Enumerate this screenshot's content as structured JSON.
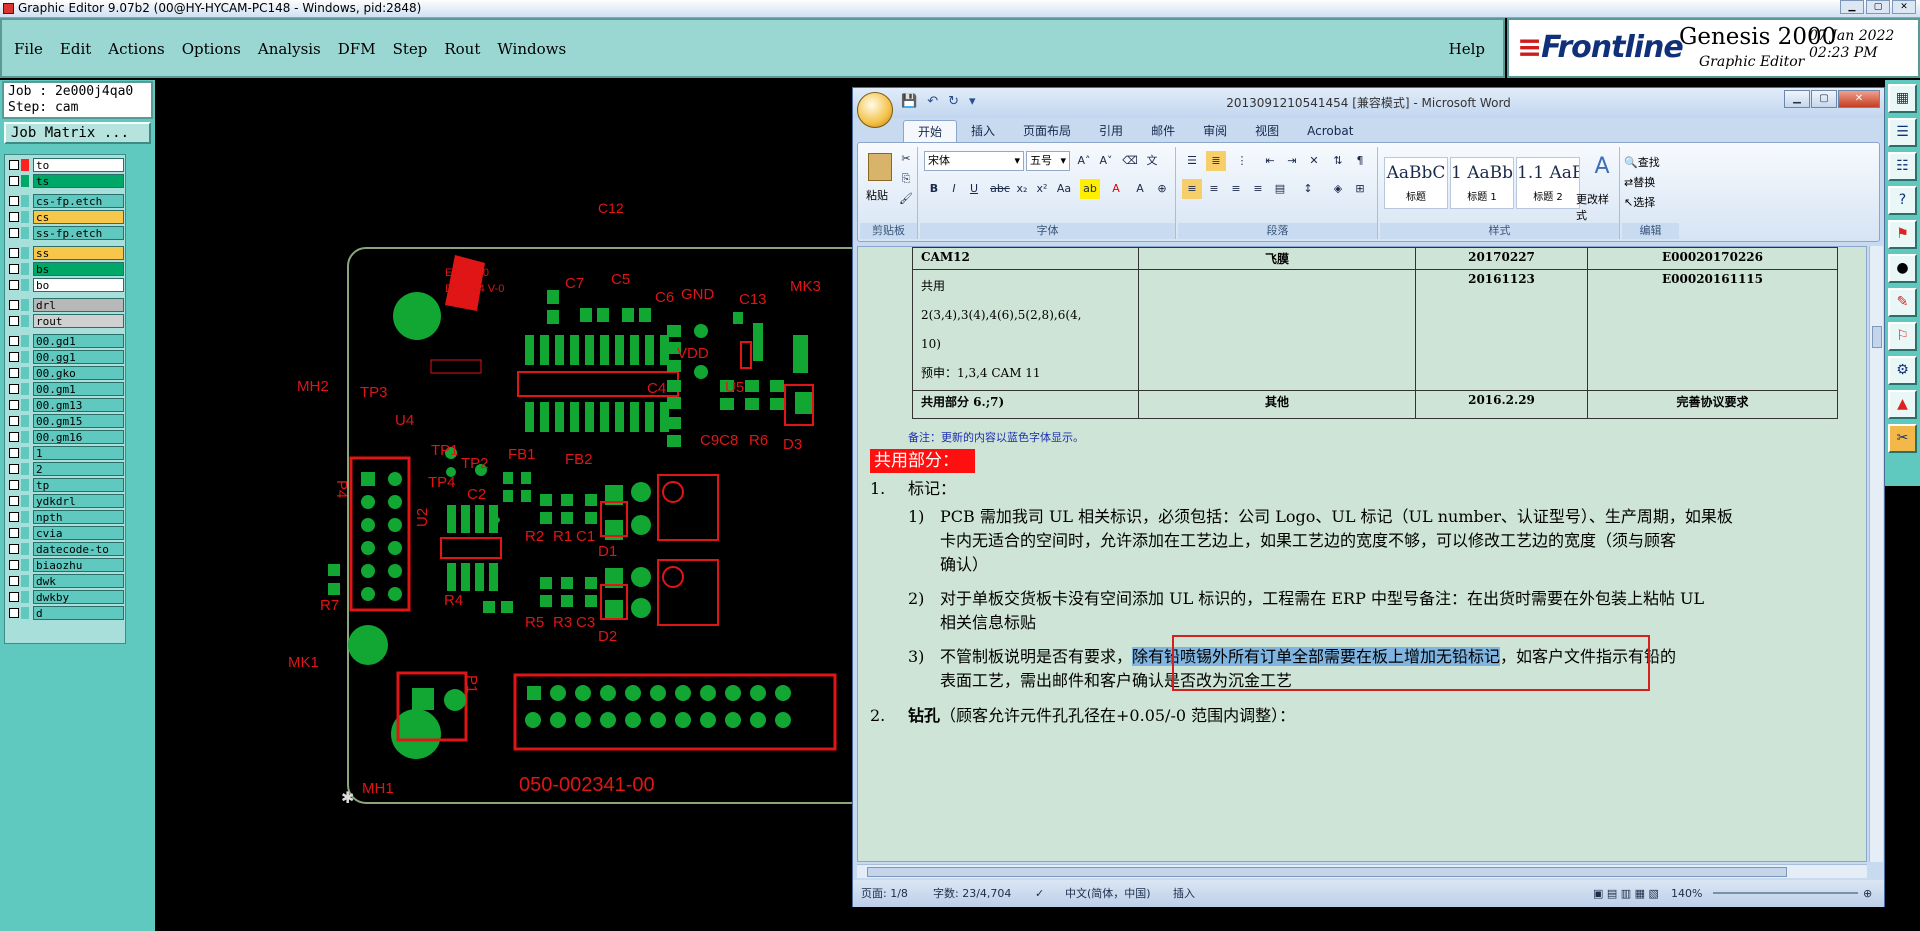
{
  "genesis": {
    "title": "Graphic Editor 9.07b2 (00@HY-HYCAM-PC148 - Windows, pid:2848)",
    "menu": [
      "File",
      "Edit",
      "Actions",
      "Options",
      "Analysis",
      "DFM",
      "Step",
      "Rout",
      "Windows"
    ],
    "help": "Help",
    "brand": {
      "logo": "Frontline",
      "product": "Genesis 2000",
      "subtitle": "Graphic Editor",
      "date": "07 Jan 2022",
      "time": "02:23 PM"
    },
    "job": "Job : 2e000j4qa0",
    "step": "Step: cam",
    "job_matrix": "Job Matrix ...",
    "layers": [
      {
        "name": "to",
        "color": "#ffffff",
        "swatch": "#ff2020"
      },
      {
        "name": "ts",
        "color": "#00a868",
        "swatch": "#00a868"
      },
      {
        "name": "cs-fp.etch",
        "color": "#5fc9c0",
        "swatch": "#5fc9c0",
        "gap": true
      },
      {
        "name": "cs",
        "color": "#f7c74b",
        "swatch": "#5fc9c0"
      },
      {
        "name": "ss-fp.etch",
        "color": "#5fc9c0",
        "swatch": "#5fc9c0"
      },
      {
        "name": "ss",
        "color": "#f7c74b",
        "swatch": "#5fc9c0",
        "gap": true
      },
      {
        "name": "bs",
        "color": "#00a868",
        "swatch": "#5fc9c0"
      },
      {
        "name": "bo",
        "color": "#ffffff",
        "swatch": "#5fc9c0"
      },
      {
        "name": "drl",
        "color": "#b8b8b8",
        "swatch": "#5fc9c0",
        "gap": true
      },
      {
        "name": "rout",
        "color": "#d0d0d0",
        "swatch": "#5fc9c0"
      },
      {
        "name": "00.gd1",
        "color": "#5fc9c0",
        "swatch": "#5fc9c0",
        "gap": true
      },
      {
        "name": "00.gg1",
        "color": "#5fc9c0",
        "swatch": "#5fc9c0"
      },
      {
        "name": "00.gko",
        "color": "#5fc9c0",
        "swatch": "#5fc9c0"
      },
      {
        "name": "00.gm1",
        "color": "#5fc9c0",
        "swatch": "#5fc9c0"
      },
      {
        "name": "00.gm13",
        "color": "#5fc9c0",
        "swatch": "#5fc9c0"
      },
      {
        "name": "00.gm15",
        "color": "#5fc9c0",
        "swatch": "#5fc9c0"
      },
      {
        "name": "00.gm16",
        "color": "#5fc9c0",
        "swatch": "#5fc9c0"
      },
      {
        "name": "1",
        "color": "#5fc9c0",
        "swatch": "#5fc9c0"
      },
      {
        "name": "2",
        "color": "#5fc9c0",
        "swatch": "#5fc9c0"
      },
      {
        "name": "tp",
        "color": "#5fc9c0",
        "swatch": "#5fc9c0"
      },
      {
        "name": "ydkdrl",
        "color": "#5fc9c0",
        "swatch": "#5fc9c0"
      },
      {
        "name": "npth",
        "color": "#5fc9c0",
        "swatch": "#5fc9c0"
      },
      {
        "name": "cvia",
        "color": "#5fc9c0",
        "swatch": "#5fc9c0"
      },
      {
        "name": "datecode-to",
        "color": "#5fc9c0",
        "swatch": "#5fc9c0"
      },
      {
        "name": "biaozhu",
        "color": "#5fc9c0",
        "swatch": "#5fc9c0"
      },
      {
        "name": "dwk",
        "color": "#5fc9c0",
        "swatch": "#5fc9c0"
      },
      {
        "name": "dwkby",
        "color": "#5fc9c0",
        "swatch": "#5fc9c0"
      },
      {
        "name": "d",
        "color": "#5fc9c0",
        "swatch": "#5fc9c0"
      }
    ],
    "pcb_labels": {
      "c12": "C12",
      "c7": "C7",
      "c5": "C5",
      "c6": "C6",
      "gnd": "GND",
      "c13": "C13",
      "mk3": "MK3",
      "e204460": "E204460",
      "d1s": "D1 S 94 V-0",
      "mh2": "MH2",
      "tp3": "TP3",
      "u4": "U4",
      "vdd": "VDD",
      "c4": "C4",
      "u5": "U5",
      "c9c8": "C9C8",
      "r6": "R6",
      "d3": "D3",
      "tp1": "TP1",
      "tp2": "TP2",
      "fb1": "FB1",
      "fb2": "FB2",
      "p4": "P4",
      "tp4": "TP4",
      "c2": "C2",
      "u2": "U2",
      "r2": "R2",
      "r1": "R1",
      "c1": "C1",
      "d1": "D1",
      "r7": "R7",
      "r4": "R4",
      "mk1": "MK1",
      "r5": "R5",
      "r3": "R3",
      "c3": "C3",
      "d2": "D2",
      "p1": "P1",
      "mh1": "MH1",
      "partno": "050-002341-00"
    }
  },
  "word": {
    "title": "2013091210541454 [兼容模式] - Microsoft Word",
    "tabs": [
      "开始",
      "插入",
      "页面布局",
      "引用",
      "邮件",
      "审阅",
      "视图",
      "Acrobat"
    ],
    "font_name": "宋体",
    "font_size": "五号",
    "groups": {
      "clipboard": "剪贴板",
      "font": "字体",
      "paragraph": "段落",
      "styles": "样式",
      "editing": "编辑"
    },
    "paste": "粘贴",
    "styles": [
      {
        "preview": "AaBbC",
        "name": "标题"
      },
      {
        "preview": "1 AaBb(",
        "name": "标题 1"
      },
      {
        "preview": "1.1 AaBb",
        "name": "标题 2"
      }
    ],
    "change_styles": "更改样式",
    "editing": [
      "查找",
      "替换",
      "选择"
    ],
    "table": {
      "row1": [
        "CAM12",
        "飞膜",
        "20170227",
        "E00020170226"
      ],
      "row2": [
        "共用",
        "",
        "20161123",
        "E00020161115"
      ],
      "row2_lines": [
        "2(3,4),3(4),4(6),5(2,8),6(4,",
        "10)",
        "预申：1,3,4 CAM 11"
      ],
      "row3": [
        "共用部分 6.;7)",
        "其他",
        "2016.2.29",
        "完善协议要求"
      ]
    },
    "note": "备注：更新的内容以蓝色字体显示。",
    "section_title": "共用部分：",
    "item1": {
      "num": "1.",
      "title": "标记："
    },
    "sub1": {
      "num": "1)",
      "lines": [
        "PCB 需加我司 UL 相关标识，必须包括：公司 Logo、UL 标记（UL number、认证型号）、生产周期，如果板",
        "卡内无适合的空间时，允许添加在工艺边上，如果工艺边的宽度不够，可以修改工艺边的宽度（须与顾客",
        "确认）"
      ]
    },
    "sub2": {
      "num": "2)",
      "lines": [
        "对于单板交货板卡没有空间添加 UL 标识的，工程需在 ERP 中型号备注：在出货时需要在外包装上粘帖 UL",
        "相关信息标贴"
      ]
    },
    "sub3": {
      "num": "3)",
      "pre": "不管制板说明是否有要求，",
      "highlight": "除有铅喷锡外所有订单全部需要在板上增加无铅标记",
      "post": "，如客户文件指示有铅的",
      "line2": "表面工艺，需出邮件和客户确认是否改为沉金工艺"
    },
    "item2": {
      "num": "2.",
      "title": "钻孔",
      "rest": "（顾客允许元件孔孔径在+0.05/-0 范围内调整）："
    },
    "status": {
      "page": "页面: 1/8",
      "words": "字数: 23/4,704",
      "lang": "中文(简体，中国)",
      "mode": "插入",
      "zoom": "140%"
    }
  }
}
